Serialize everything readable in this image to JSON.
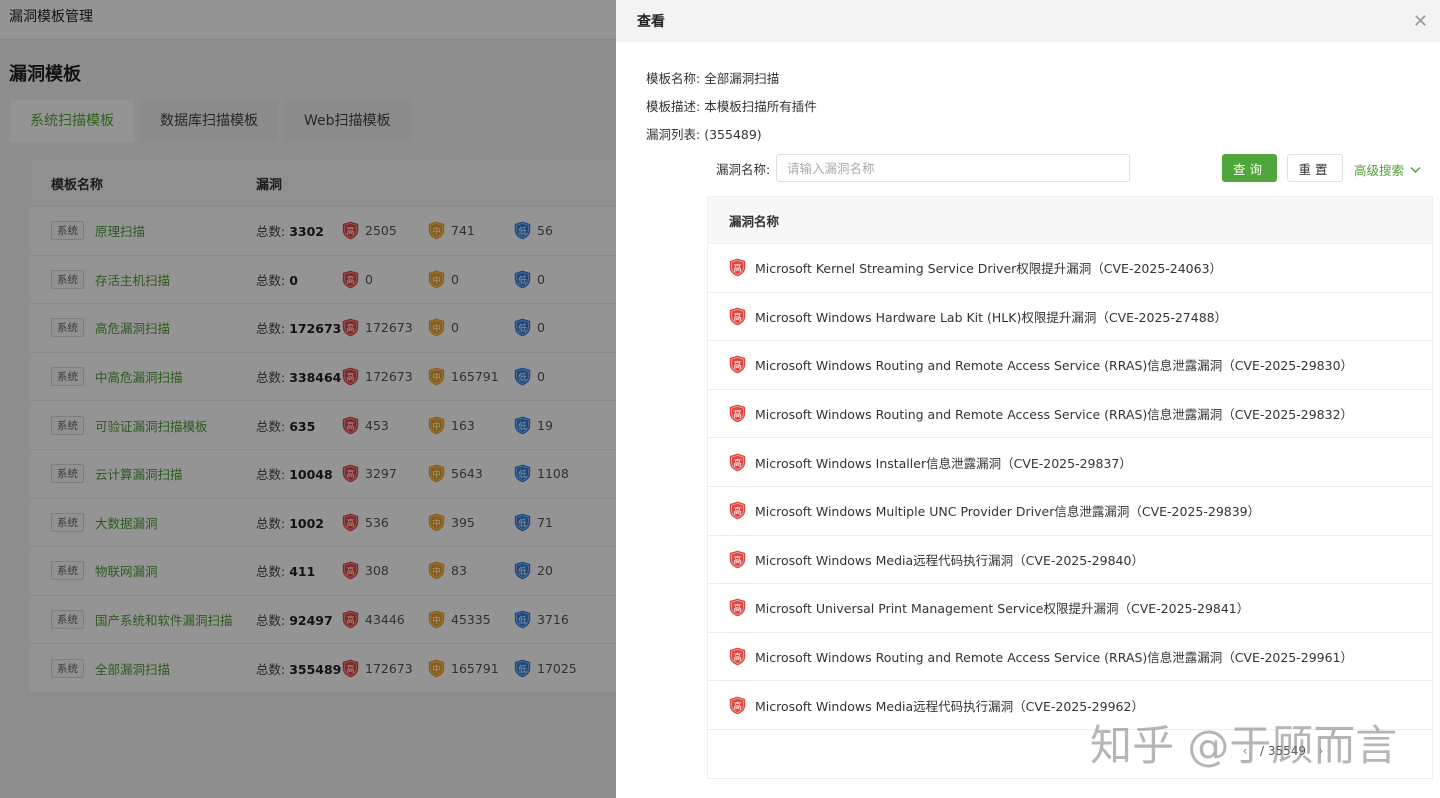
{
  "topbar": {
    "title": "漏洞模板管理"
  },
  "page": {
    "title": "漏洞模板",
    "tabs": [
      {
        "label": "系统扫描模板",
        "active": true
      },
      {
        "label": "数据库扫描模板",
        "active": false
      },
      {
        "label": "Web扫描模板",
        "active": false
      }
    ],
    "table": {
      "headers": {
        "name": "模板名称",
        "vuln": "漏洞"
      },
      "total_label": "总数: ",
      "tag": "系统",
      "rows": [
        {
          "name": "原理扫描",
          "total": "3302",
          "high": "2505",
          "mid": "741",
          "low": "56"
        },
        {
          "name": "存活主机扫描",
          "total": "0",
          "high": "0",
          "mid": "0",
          "low": "0"
        },
        {
          "name": "高危漏洞扫描",
          "total": "172673",
          "high": "172673",
          "mid": "0",
          "low": "0"
        },
        {
          "name": "中高危漏洞扫描",
          "total": "338464",
          "high": "172673",
          "mid": "165791",
          "low": "0"
        },
        {
          "name": "可验证漏洞扫描模板",
          "total": "635",
          "high": "453",
          "mid": "163",
          "low": "19"
        },
        {
          "name": "云计算漏洞扫描",
          "total": "10048",
          "high": "3297",
          "mid": "5643",
          "low": "1108"
        },
        {
          "name": "大数据漏洞",
          "total": "1002",
          "high": "536",
          "mid": "395",
          "low": "71"
        },
        {
          "name": "物联网漏洞",
          "total": "411",
          "high": "308",
          "mid": "83",
          "low": "20"
        },
        {
          "name": "国产系统和软件漏洞扫描",
          "total": "92497",
          "high": "43446",
          "mid": "45335",
          "low": "3716"
        },
        {
          "name": "全部漏洞扫描",
          "total": "355489",
          "high": "172673",
          "mid": "165791",
          "low": "17025"
        }
      ]
    }
  },
  "levels": {
    "high": {
      "glyph": "高",
      "color": "#e0443e"
    },
    "mid": {
      "glyph": "中",
      "color": "#f0a020"
    },
    "low": {
      "glyph": "低",
      "color": "#2f7ee0"
    }
  },
  "drawer": {
    "title": "查看",
    "close_icon": "close-icon",
    "template_name_label": "模板名称:",
    "template_name": "全部漏洞扫描",
    "template_desc_label": "模板描述:",
    "template_desc": "本模板扫描所有插件",
    "vuln_list_label": "漏洞列表:",
    "vuln_list_count": "(355489)",
    "search": {
      "label": "漏洞名称:",
      "placeholder": "请输入漏洞名称",
      "query_button": "查询",
      "reset_button": "重置",
      "advanced": "高级搜索"
    },
    "vuln_table": {
      "header": "漏洞名称",
      "rows": [
        "Microsoft Kernel Streaming Service Driver权限提升漏洞（CVE-2025-24063）",
        "Microsoft Windows Hardware Lab Kit (HLK)权限提升漏洞（CVE-2025-27488）",
        "Microsoft Windows Routing and Remote Access Service (RRAS)信息泄露漏洞（CVE-2025-29830）",
        "Microsoft Windows Routing and Remote Access Service (RRAS)信息泄露漏洞（CVE-2025-29832）",
        "Microsoft Windows Installer信息泄露漏洞（CVE-2025-29837）",
        "Microsoft Windows Multiple UNC Provider Driver信息泄露漏洞（CVE-2025-29839）",
        "Microsoft Windows Media远程代码执行漏洞（CVE-2025-29840）",
        "Microsoft Universal Print Management Service权限提升漏洞（CVE-2025-29841）",
        "Microsoft Windows Routing and Remote Access Service (RRAS)信息泄露漏洞（CVE-2025-29961）",
        "Microsoft Windows Media远程代码执行漏洞（CVE-2025-29962）"
      ]
    },
    "pager": {
      "prev": "‹",
      "text": "/ 35549",
      "next": "›"
    }
  },
  "watermark": "知乎 @于顾而言"
}
